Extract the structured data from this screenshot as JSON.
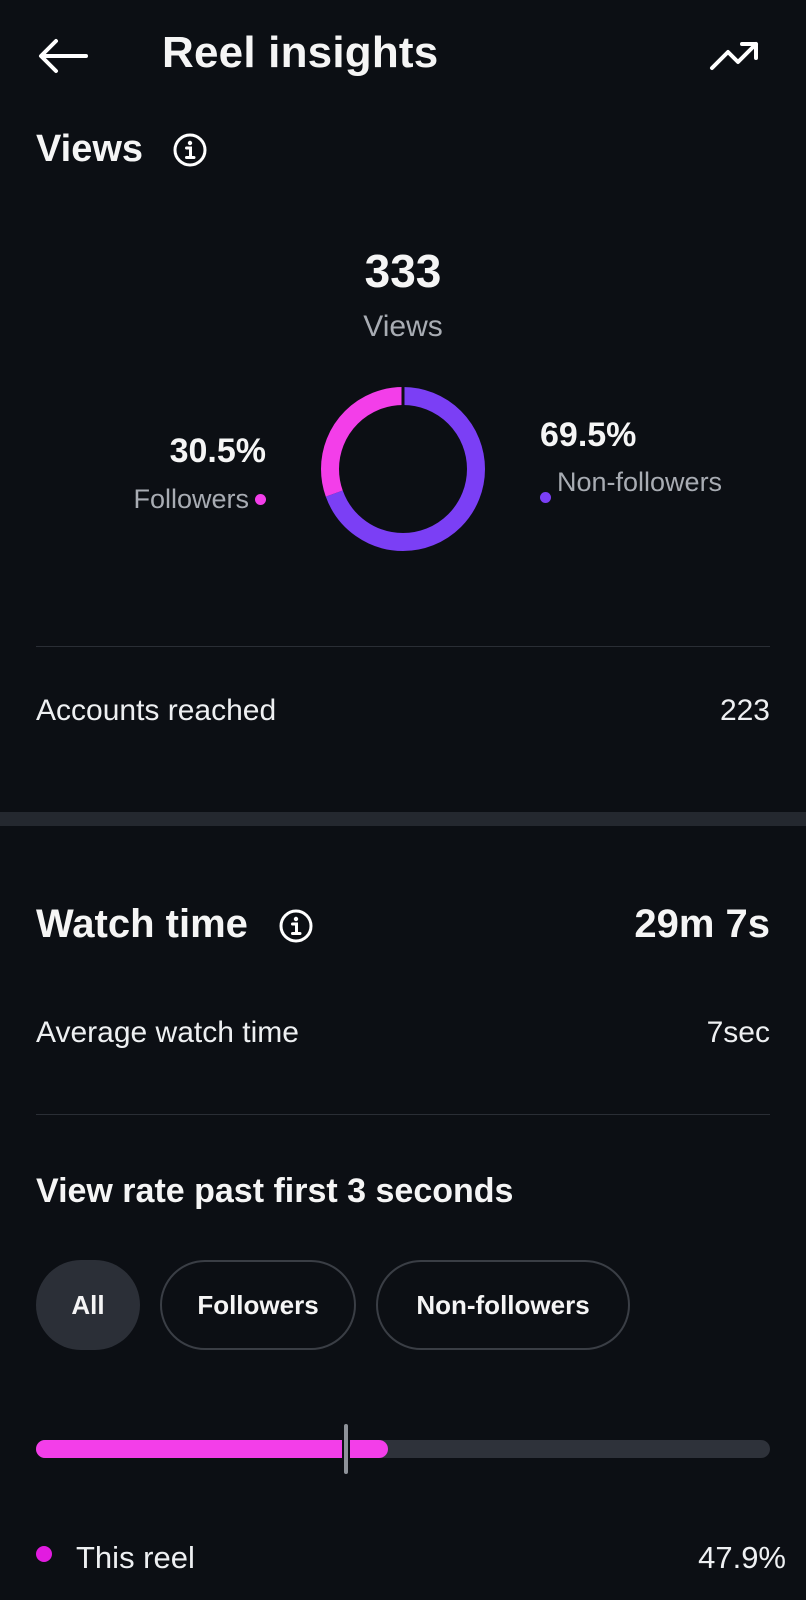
{
  "header": {
    "title": "Reel insights",
    "back_icon": "arrow-left-icon",
    "trend_icon": "trending-up-icon"
  },
  "views": {
    "heading": "Views",
    "info_icon": "info-icon",
    "count": "333",
    "count_label": "Views",
    "followers_pct_text": "30.5%",
    "followers_label": "Followers",
    "nonfollowers_pct_text": "69.5%",
    "nonfollowers_label": "Non-followers",
    "followers_fraction": 0.305,
    "nonfollowers_fraction": 0.695
  },
  "accounts_reached": {
    "label": "Accounts reached",
    "value": "223"
  },
  "watch_time": {
    "heading": "Watch time",
    "total": "29m 7s",
    "average_label": "Average watch time",
    "average_value": "7sec"
  },
  "view_rate": {
    "heading": "View rate past first 3 seconds",
    "filters": [
      "All",
      "Followers",
      "Non-followers"
    ],
    "selected_filter": "All",
    "this_reel_fraction": 0.479,
    "this_reel_label": "This reel",
    "this_reel_value": "47.9%"
  },
  "colors": {
    "followers": "#f33ee9",
    "nonfollowers": "#7b3ff5",
    "background": "#0c0f14"
  }
}
